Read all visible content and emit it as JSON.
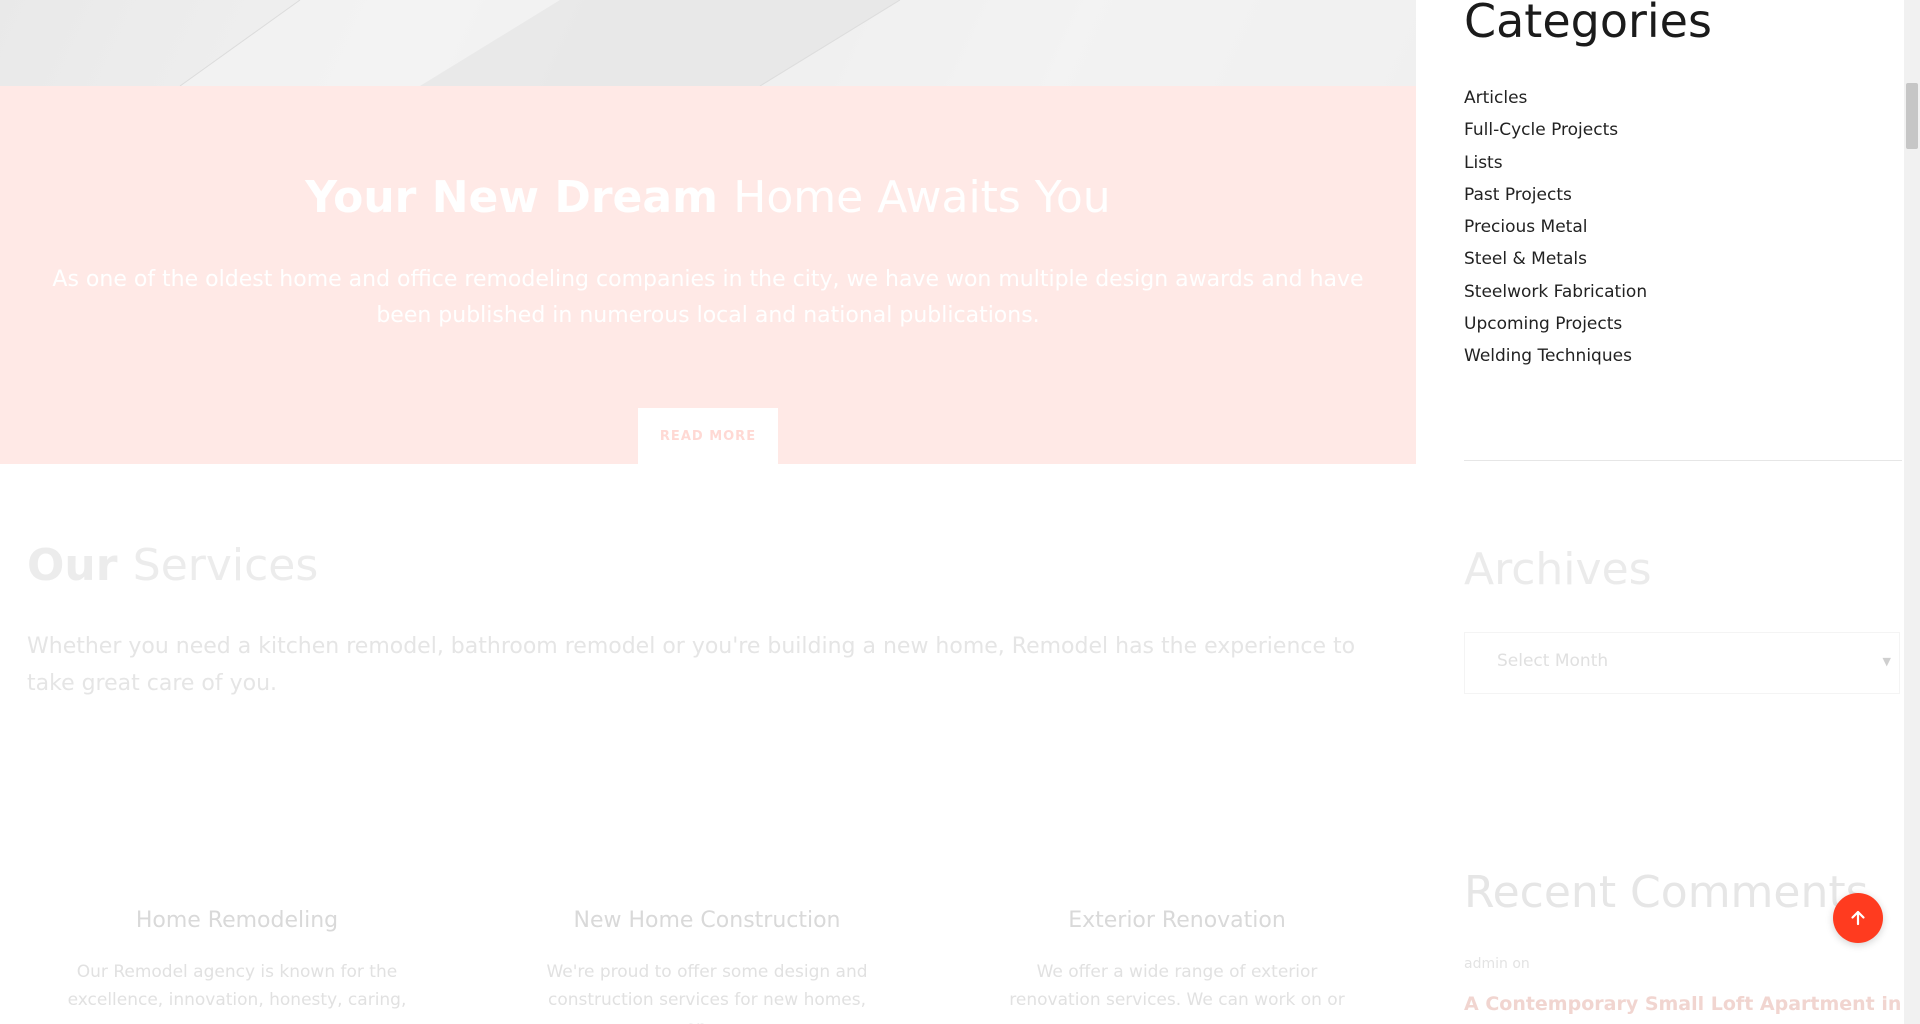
{
  "hero": {
    "title_strong": "Your New Dream",
    "title_light": "Home Awaits You",
    "text": "As one of the oldest home and office remodeling companies in the city, we have won multiple design awards and have been published in numerous local and national publications.",
    "button_label": "READ MORE"
  },
  "services": {
    "title_strong": "Our",
    "title_light": "Services",
    "intro": "Whether you need a kitchen remodel, bathroom remodel or you're building a new home, Remodel has the experience to take great care of you.",
    "items": [
      {
        "title": "Home Remodeling",
        "text": "Our Remodel agency is known for the excellence, innovation, honesty, caring, ..."
      },
      {
        "title": "New Home Construction",
        "text": "We're proud to offer some design and construction services for new homes, on ..."
      },
      {
        "title": "Exterior Renovation",
        "text": "We offer a wide range of exterior renovation services. We can work on or ..."
      }
    ]
  },
  "sidebar": {
    "categories_title": "Categories",
    "categories": [
      "Articles",
      "Full-Cycle Projects",
      "Lists",
      "Past Projects",
      "Precious Metal",
      "Steel & Metals",
      "Steelwork Fabrication",
      "Upcoming Projects",
      "Welding Techniques"
    ],
    "archives_title": "Archives",
    "archives_select": "Select Month",
    "recent_comments_title": "Recent Comments",
    "comment_author": "admin on",
    "comment_post": "A Contemporary Small Loft Apartment in Taiwan"
  },
  "icons": {
    "back_to_top": "arrow-up-icon",
    "select_chevron": "chevron-down-icon"
  },
  "colors": {
    "hero_background": "#ffe9e6",
    "accent": "#ff3b1f"
  }
}
